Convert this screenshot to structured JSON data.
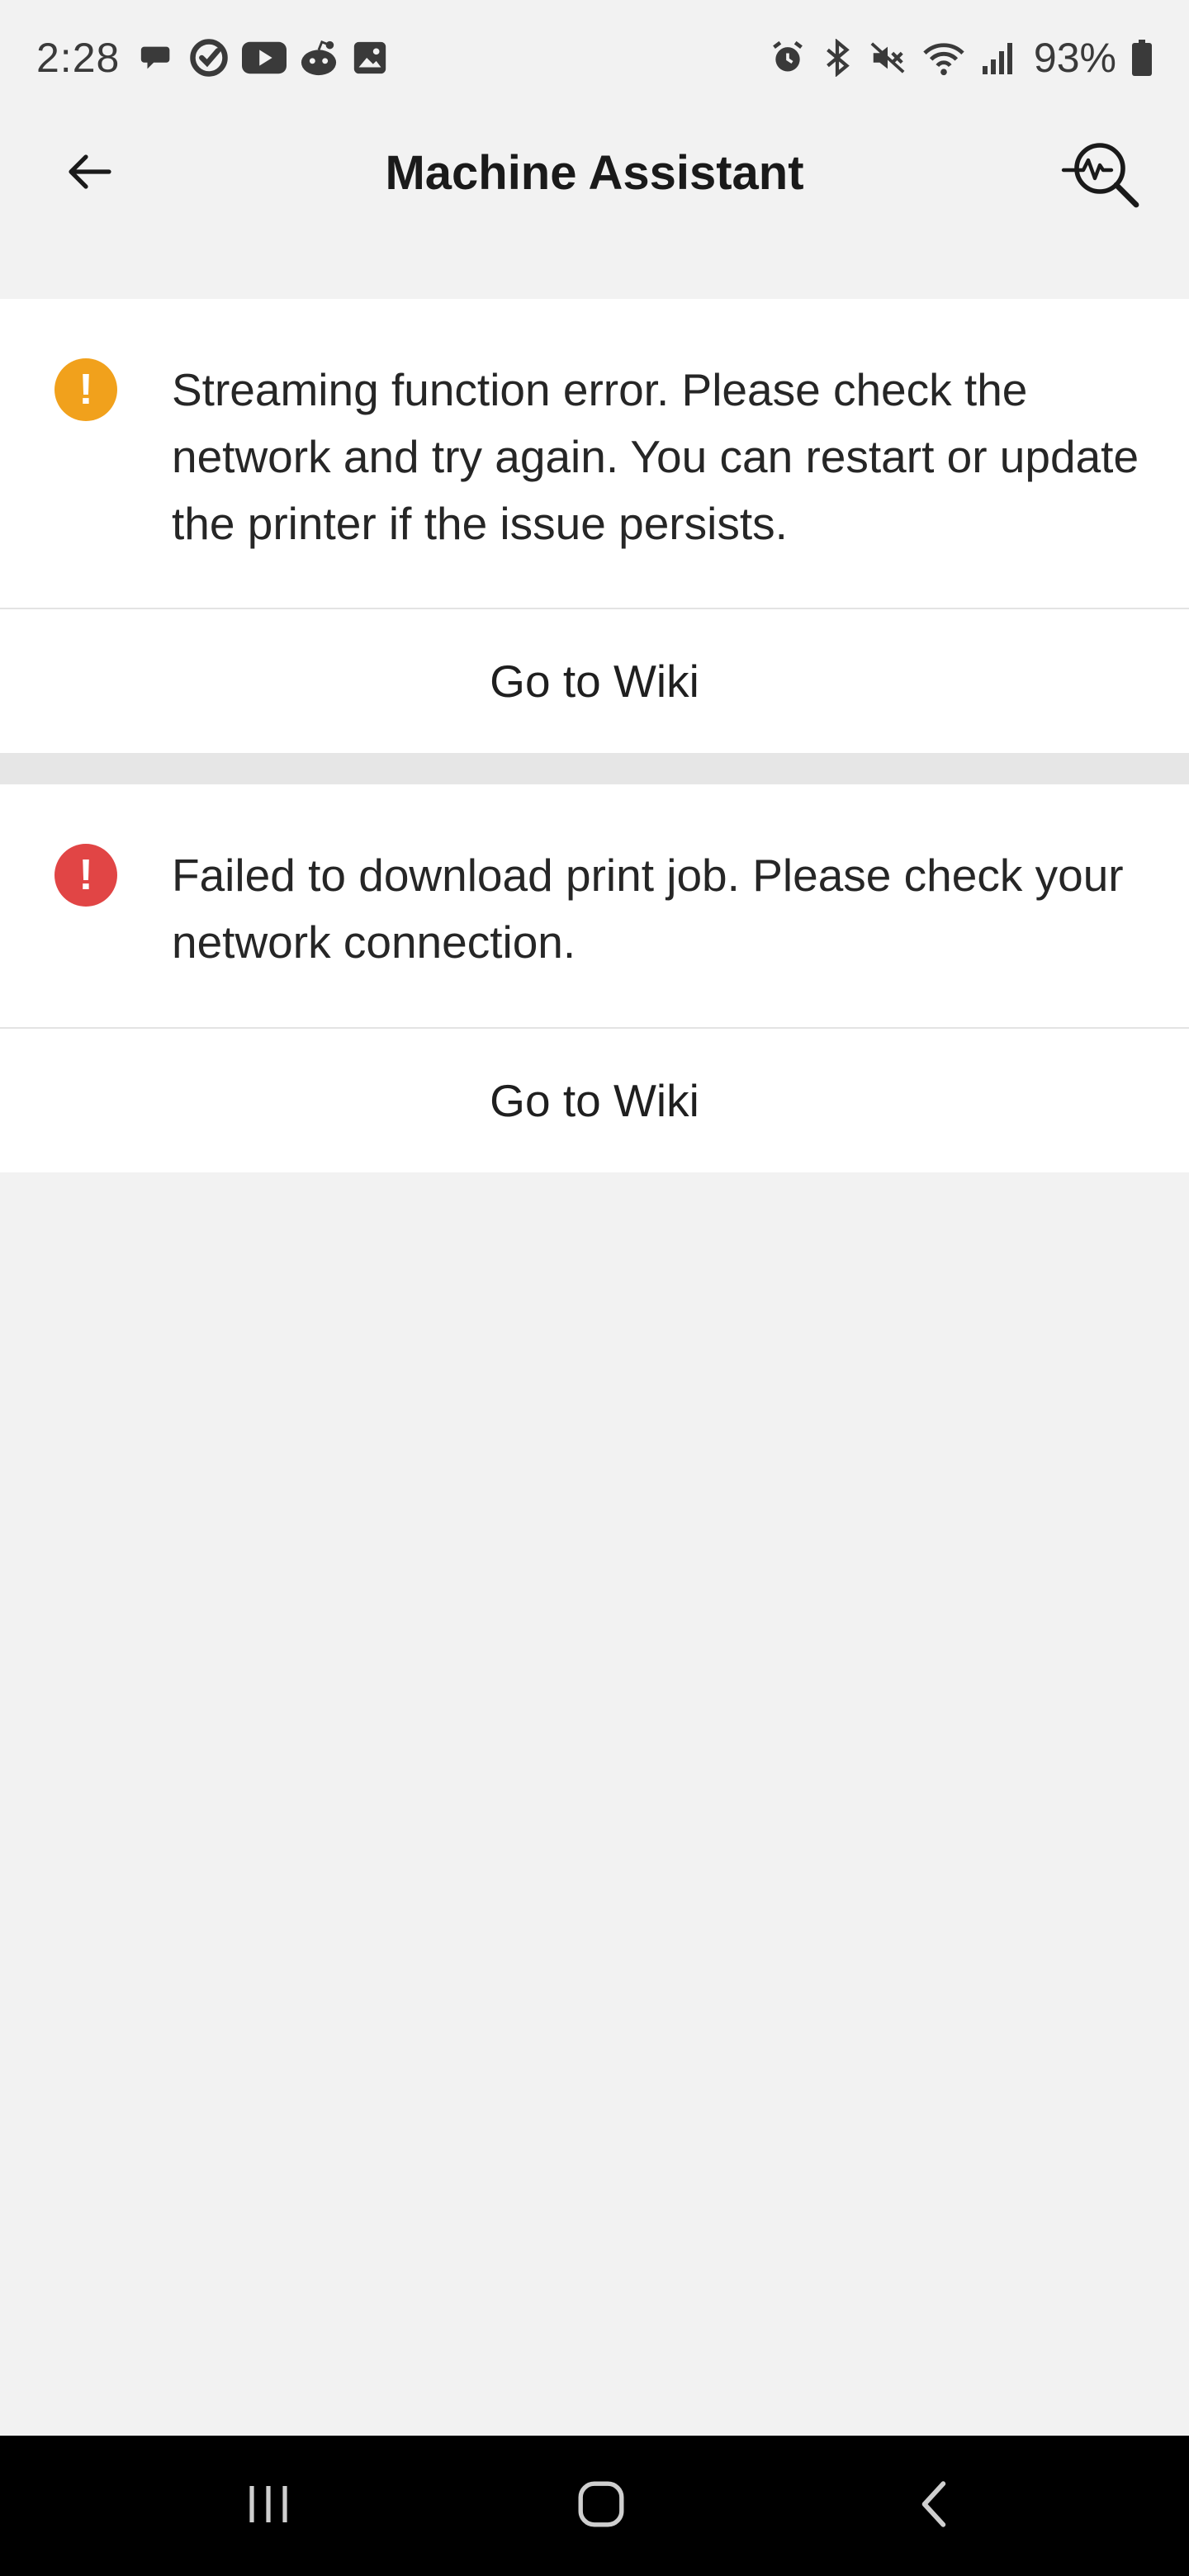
{
  "status_bar": {
    "time": "2:28",
    "battery": "93%",
    "left_icons": [
      "chat-bubble-icon",
      "sync-check-icon",
      "youtube-icon",
      "reddit-icon",
      "gallery-icon"
    ],
    "right_icons": [
      "alarm-icon",
      "bluetooth-icon",
      "mute-icon",
      "wifi-icon",
      "signal-icon",
      "battery-icon"
    ]
  },
  "header": {
    "title": "Machine Assistant",
    "back_icon": "arrow-left-icon",
    "action_icon": "diagnostic-search-icon"
  },
  "alerts": [
    {
      "severity": "warning",
      "color": "#f1a11c",
      "icon": "!",
      "message": "Streaming function error. Please check the network and try again. You can restart or update the printer if the issue persists.",
      "link_label": "Go to Wiki"
    },
    {
      "severity": "error",
      "color": "#e14545",
      "icon": "!",
      "message": "Failed to download print job. Please check your network connection.",
      "link_label": "Go to Wiki"
    }
  ],
  "nav_bar": {
    "buttons": [
      "recent-apps-icon",
      "home-icon",
      "back-icon"
    ]
  }
}
